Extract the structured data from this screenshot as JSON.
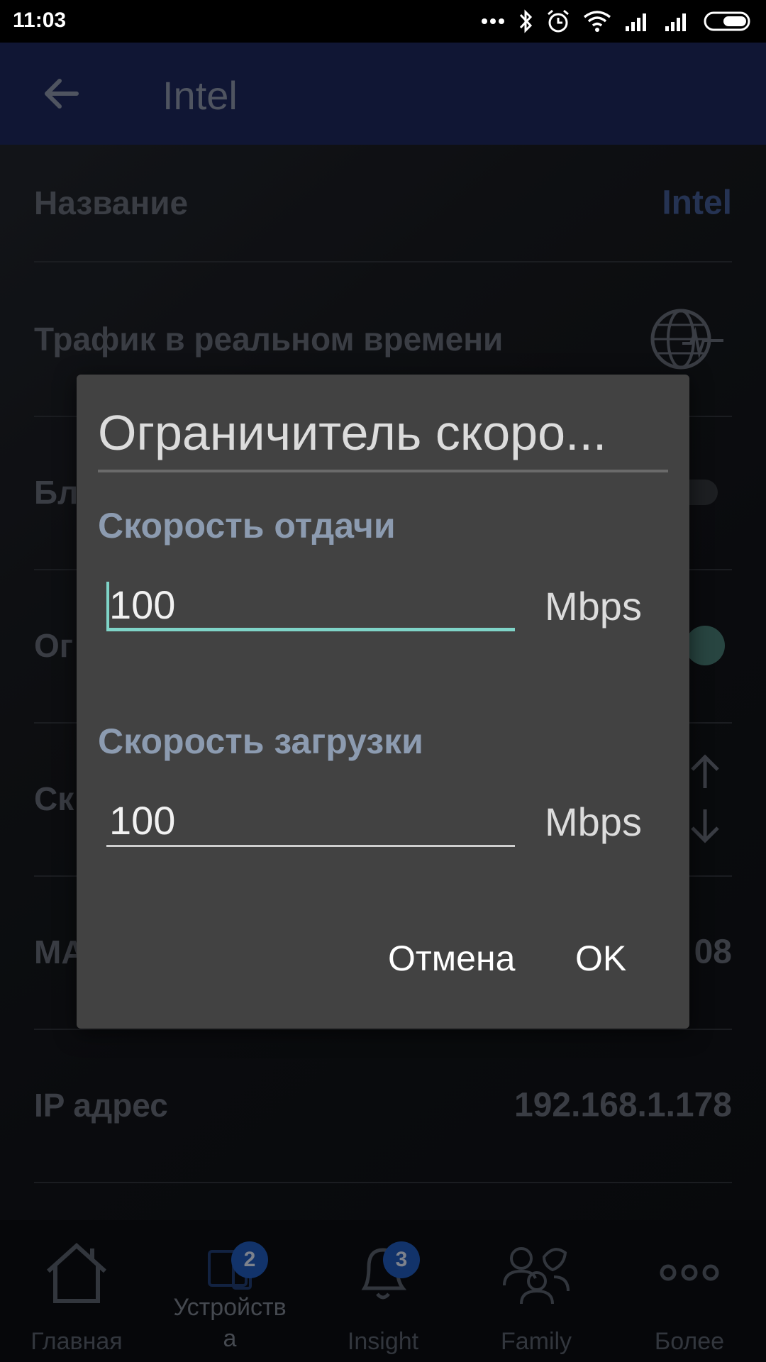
{
  "status_bar": {
    "time": "11:03",
    "icons": [
      "more-icon",
      "bluetooth-icon",
      "alarm-icon",
      "wifi-icon",
      "signal-icon",
      "signal-icon",
      "battery-icon"
    ]
  },
  "app_bar": {
    "title": "Intel",
    "back_icon": "arrow-left-icon"
  },
  "rows": [
    {
      "label": "Название",
      "value": "Intel"
    },
    {
      "label": "Трафик в реальном времени",
      "value": ""
    },
    {
      "label": "Бл",
      "value": ""
    },
    {
      "label": "Ог",
      "value": ""
    },
    {
      "label": "Ск",
      "value": ""
    },
    {
      "label": "МА",
      "value": "08"
    },
    {
      "label": "IP адрес",
      "value": "192.168.1.178"
    }
  ],
  "dialog": {
    "title": "Ограничитель скоро...",
    "upload_label": "Скорость отдачи",
    "upload_value": "100",
    "upload_unit": "Mbps",
    "download_label": "Скорость загрузки",
    "download_value": "100",
    "download_unit": "Mbps",
    "cancel_label": "Отмена",
    "ok_label": "OK"
  },
  "bottom_nav": {
    "items": [
      {
        "label": "Главная",
        "icon": "home-icon"
      },
      {
        "label_line1": "Устройств",
        "label_line2": "а",
        "icon": "devices-icon",
        "badge": "2"
      },
      {
        "label": "Insight",
        "icon": "bell-icon",
        "badge": "3"
      },
      {
        "label": "Family",
        "icon": "family-icon"
      },
      {
        "label": "Более",
        "icon": "more-dots-icon"
      }
    ]
  },
  "colors": {
    "app_bar": "#1a2350",
    "dialog_bg": "#424242",
    "accent": "#7fd4c8",
    "section_label": "#8c9bb0",
    "badge": "#1d4fa3"
  }
}
